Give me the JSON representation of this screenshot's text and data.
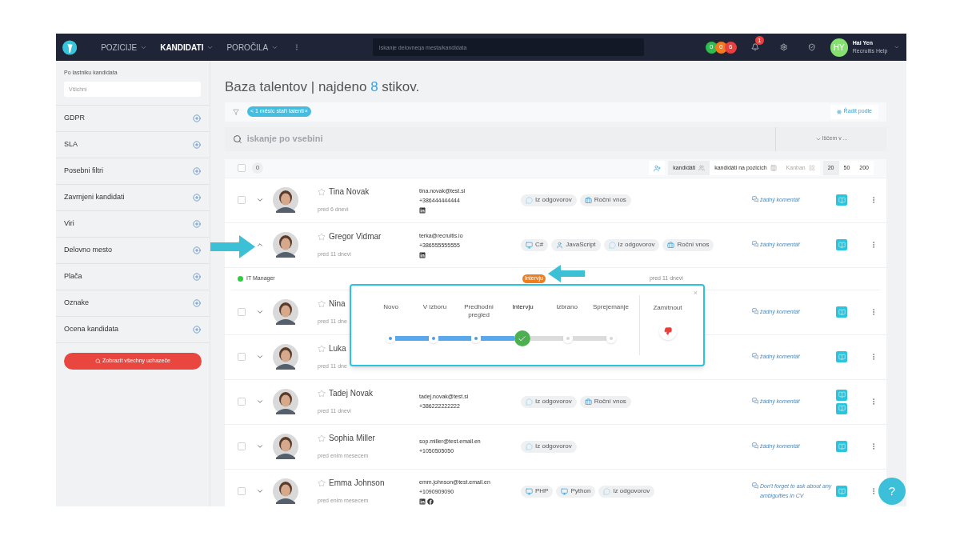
{
  "nav": {
    "items": [
      {
        "label": "POZICIJE",
        "selected": false
      },
      {
        "label": "KANDIDATI",
        "selected": true
      },
      {
        "label": "POROČILA",
        "selected": false
      }
    ],
    "search_placeholder": "Iskanje delovnega mesta/kandidata",
    "counters": [
      {
        "value": "0",
        "color": "#2ebd4e"
      },
      {
        "value": "0",
        "color": "#f47a1f"
      },
      {
        "value": "6",
        "color": "#e9403f"
      }
    ],
    "notifications": "1",
    "user": {
      "initials": "HY",
      "name": "Hai Yen",
      "company": "Recruitis Help"
    }
  },
  "sidebar": {
    "owner_label": "Po lastniku kandidata",
    "owner_placeholder": "Všichni",
    "filters": [
      "GDPR",
      "SLA",
      "Posebni filtri",
      "Zavrnjeni kandidati",
      "Viri",
      "Delovno mesto",
      "Plača",
      "Oznake",
      "Ocena kandidata"
    ],
    "show_all_button": "Zobrazit všechny uchazeče"
  },
  "title": {
    "prefix": "Baza talentov | najdeno",
    "count": "8",
    "suffix": "stikov."
  },
  "filter_chip": "< 1 měsíc staří talenti",
  "chip_remove": "×",
  "sort_button": "Řadit podle",
  "search": {
    "placeholder": "iskanje po vsebini",
    "scope": "Iščem v ..."
  },
  "toolbar": {
    "select_all_checked": false,
    "selected_count": "0",
    "views": [
      {
        "label": "kandidáti",
        "selected": true,
        "disabled": false
      },
      {
        "label": "kandidáti na pozicích",
        "selected": false,
        "disabled": false
      },
      {
        "label": "Kanban",
        "selected": false,
        "disabled": true
      }
    ],
    "page_sizes": [
      {
        "label": "20",
        "selected": true
      },
      {
        "label": "50",
        "selected": false
      },
      {
        "label": "200",
        "selected": false
      }
    ]
  },
  "rows": [
    {
      "name": "Tina Novak",
      "date": "pred 6 dnevi",
      "email": "tina.novak@test.si",
      "phone": "+386444444444",
      "socials": [
        {
          "kind": "linkedin"
        }
      ],
      "tags": [
        {
          "kind": "chat",
          "label": "Iz odgovorov"
        },
        {
          "kind": "briefcase",
          "label": "Roční vnos"
        }
      ],
      "comment": "žádný komentář",
      "documents": [
        {
          "kind": "cv"
        }
      ],
      "expanded": false,
      "checked": false,
      "starred": false
    },
    {
      "name": "Gregor Vidmar",
      "date": "pred 11 dnevi",
      "email": "terka@recruitis.io",
      "phone": "+386555555555",
      "socials": [
        {
          "kind": "linkedin"
        }
      ],
      "tags": [
        {
          "kind": "monitor",
          "label": "C#"
        },
        {
          "kind": "user",
          "label": "JavaScript"
        },
        {
          "kind": "chat",
          "label": "Iz odgovorov"
        },
        {
          "kind": "briefcase",
          "label": "Roční vnos"
        }
      ],
      "comment": "žádný komentář",
      "documents": [
        {
          "kind": "cv"
        }
      ],
      "expanded": true,
      "checked": false,
      "starred": false,
      "position": {
        "title": "IT Manager",
        "color": "#2ecc40",
        "stage": "Intervju",
        "date": "pred 11 dnevi"
      }
    },
    {
      "name": "Nina",
      "date": "pred 11 dne",
      "comment": "žádný komentář",
      "documents": [
        {
          "kind": "cv"
        }
      ],
      "expanded": false,
      "checked": false,
      "starred": false
    },
    {
      "name": "Luka",
      "date": "pred 11 dne",
      "comment": "žádný komentář",
      "documents": [
        {
          "kind": "cv"
        }
      ],
      "expanded": false,
      "checked": false,
      "starred": false
    },
    {
      "name": "Tadej Novak",
      "date": "pred 11 dnevi",
      "email": "tadej.novak@test.si",
      "phone": "+386222222222",
      "tags": [
        {
          "kind": "chat",
          "label": "Iz odgovorov"
        },
        {
          "kind": "briefcase",
          "label": "Roční vnos"
        }
      ],
      "comment": "žádný komentář",
      "documents": [
        {
          "kind": "cv"
        },
        {
          "kind": "cv"
        }
      ],
      "expanded": false,
      "checked": false,
      "starred": false
    },
    {
      "name": "Sophia Miller",
      "date": "pred enim mesecem",
      "email": "sop.miller@test.email.en",
      "phone": "+1050505050",
      "tags": [
        {
          "kind": "chat",
          "label": "Iz odgovorov"
        }
      ],
      "comment": "žádný komentář",
      "documents": [
        {
          "kind": "cv"
        }
      ],
      "expanded": false,
      "checked": false,
      "starred": false
    },
    {
      "name": "Emma Johnson",
      "date": "pred enim mesecem",
      "email": "emm.johnson@test.email.en",
      "phone": "+1090909090",
      "socials": [
        {
          "kind": "linkedin"
        },
        {
          "kind": "facebook"
        }
      ],
      "tags": [
        {
          "kind": "monitor",
          "label": "PHP"
        },
        {
          "kind": "monitor",
          "label": "Python"
        },
        {
          "kind": "chat",
          "label": "Iz odgovorov"
        }
      ],
      "comment": "Don't forget to ask about any ambiguities in CV",
      "documents": [
        {
          "kind": "cv"
        }
      ],
      "expanded": false,
      "checked": false,
      "starred": false
    }
  ],
  "pipeline": {
    "close": "×",
    "reject": "Zamítnout",
    "stages": [
      {
        "label": "Novo",
        "done": true,
        "selected": false
      },
      {
        "label": "V izboru",
        "done": true,
        "selected": false
      },
      {
        "label": "Predhodni pregled",
        "done": true,
        "selected": false
      },
      {
        "label": "Intervju",
        "done": true,
        "selected": true
      },
      {
        "label": "Izbrano",
        "done": false,
        "selected": false
      },
      {
        "label": "Sprejemanje",
        "done": false,
        "selected": false
      }
    ]
  },
  "help": "?"
}
